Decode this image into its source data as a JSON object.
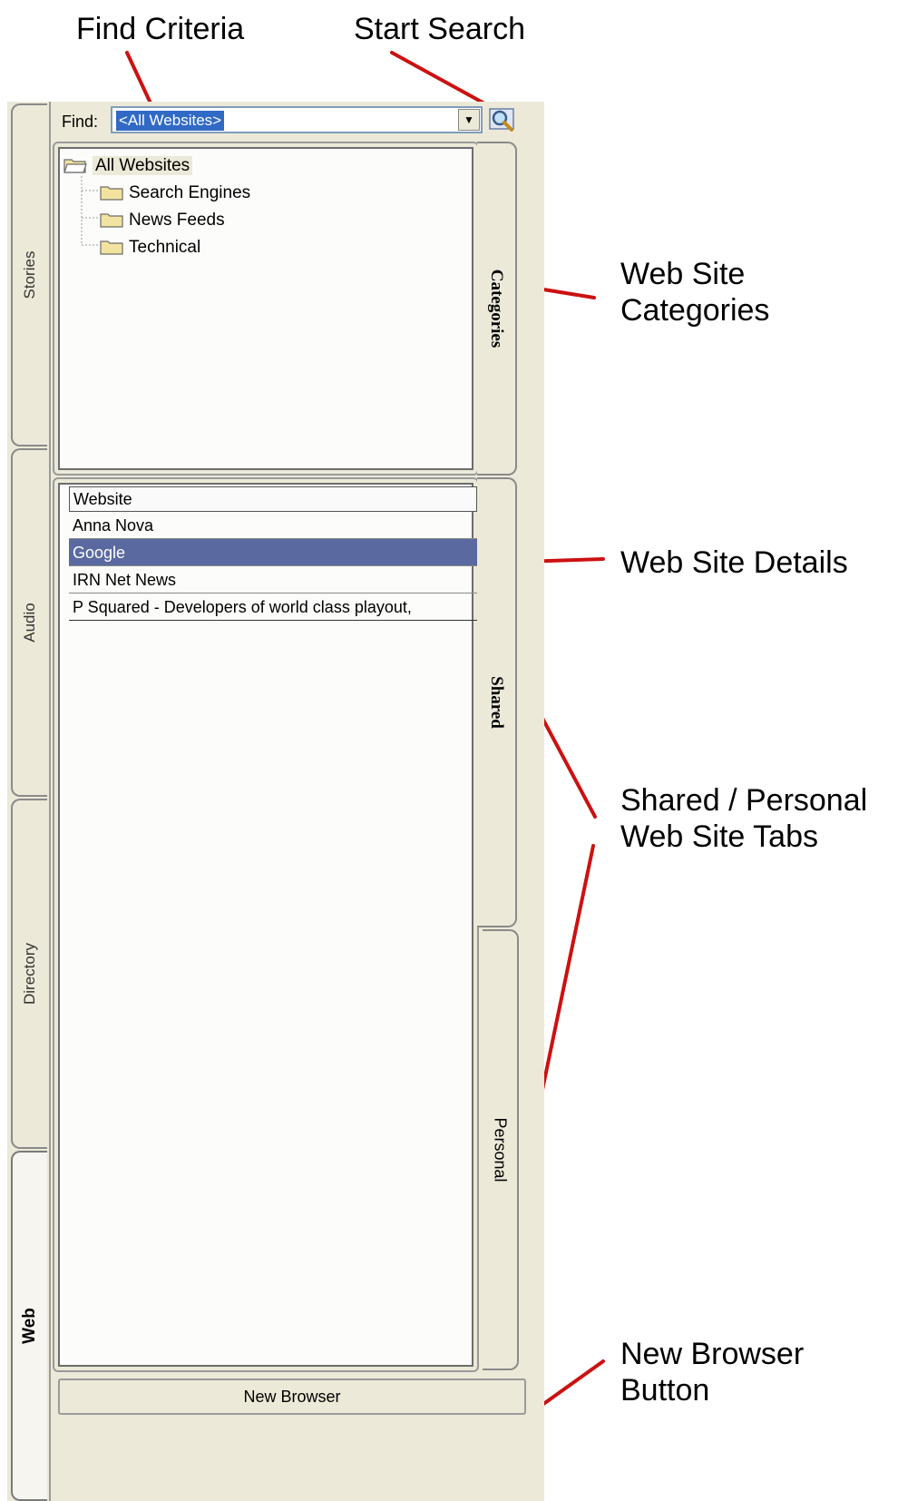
{
  "callouts": {
    "find_criteria": "Find Criteria",
    "start_search": "Start Search",
    "web_site_categories_1": "Web Site",
    "web_site_categories_2": "Categories",
    "web_site_details": "Web Site Details",
    "shared_personal_1": "Shared / Personal",
    "shared_personal_2": "Web Site Tabs",
    "new_browser_1": "New Browser",
    "new_browser_2": "Button"
  },
  "left_tabs": {
    "stories": "Stories",
    "audio": "Audio",
    "directory": "Directory",
    "web": "Web"
  },
  "find": {
    "label": "Find:",
    "value": "<All Websites>",
    "dropdown_icon": "chevron-down-icon",
    "search_icon": "magnifier-icon"
  },
  "categories": {
    "tab_label": "Categories",
    "root": "All Websites",
    "children": [
      "Search Engines",
      "News Feeds",
      "Technical"
    ]
  },
  "websites": {
    "header": "Website",
    "rows": [
      "Anna Nova",
      "Google",
      "IRN Net News",
      "P Squared - Developers of world class playout,"
    ],
    "selected_index": 1
  },
  "right_tabs": {
    "shared": "Shared",
    "personal": "Personal"
  },
  "new_browser": "New Browser",
  "colors": {
    "callout_line": "#cc1111",
    "selection": "#5a6aa0",
    "window_bg": "#ece9d8"
  }
}
